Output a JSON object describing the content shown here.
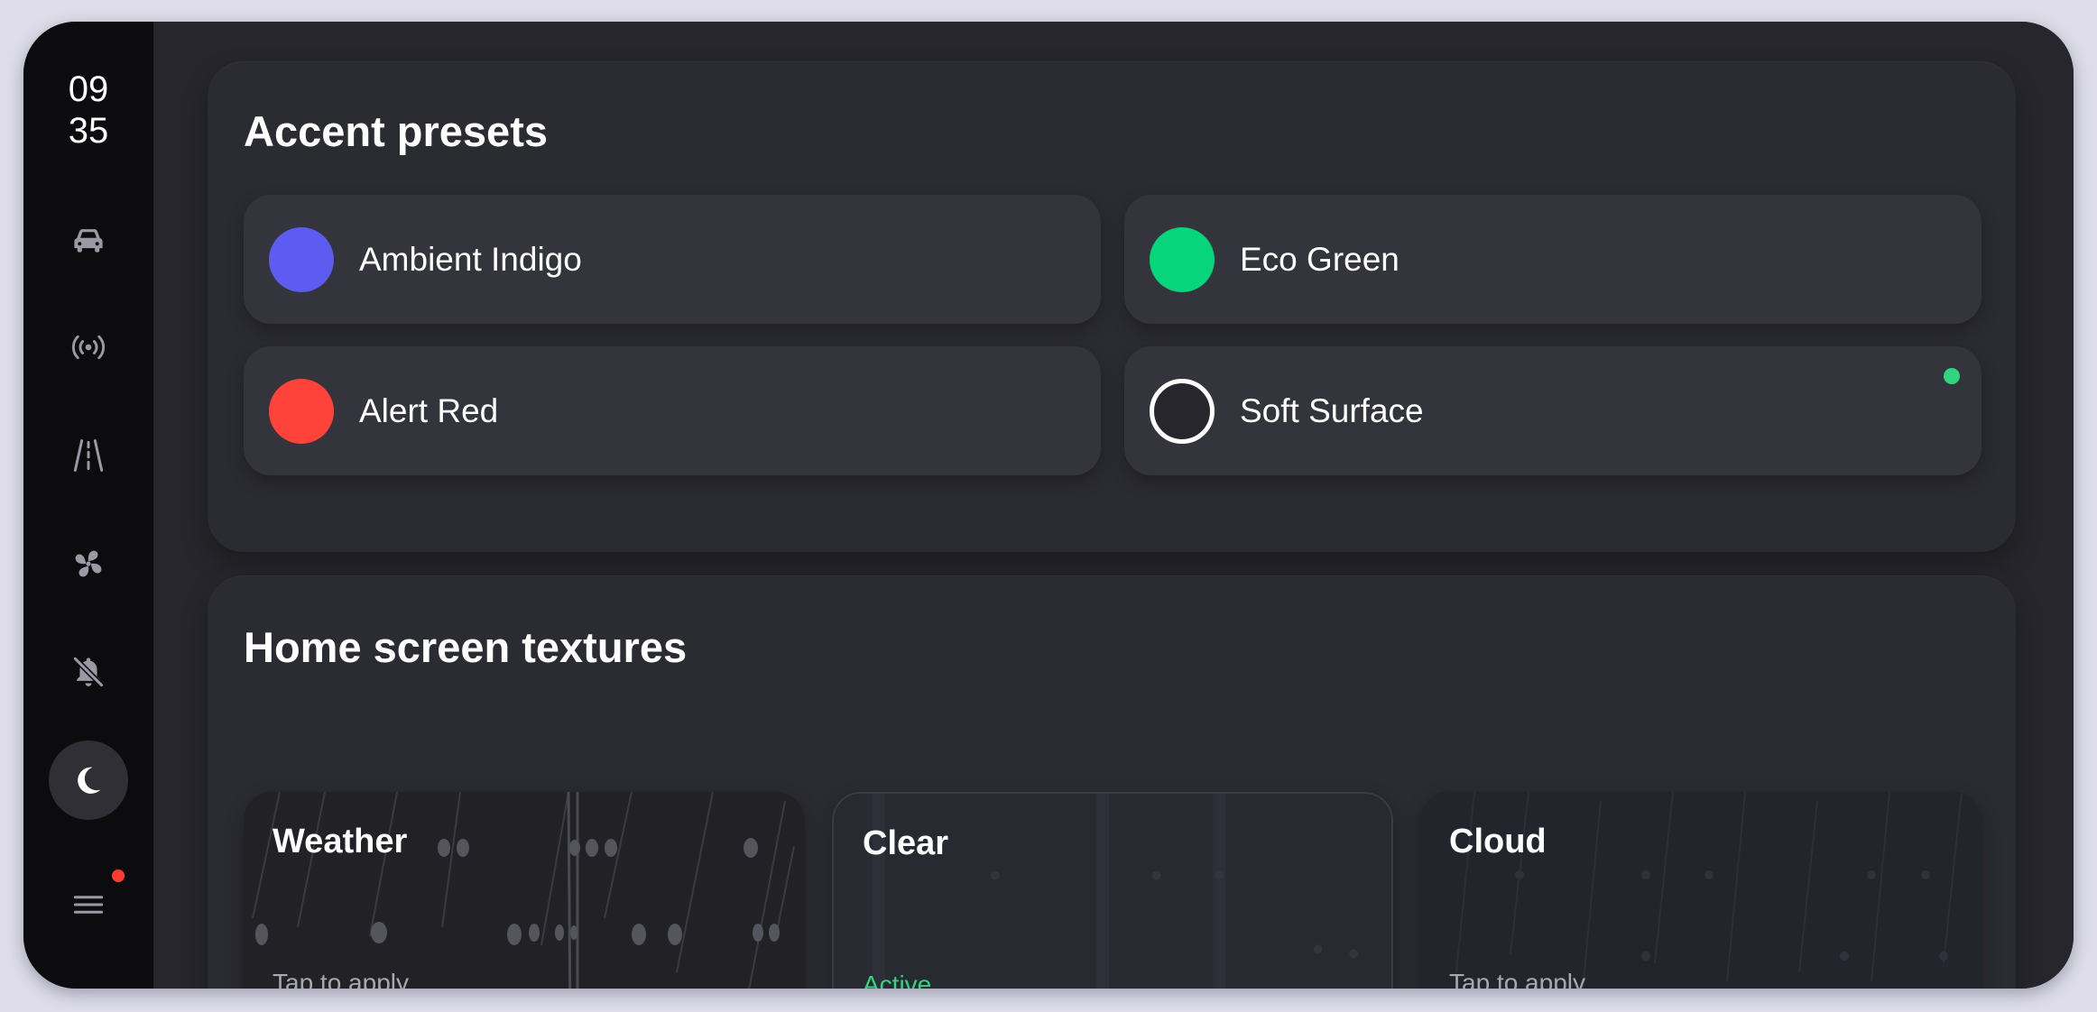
{
  "clock": {
    "hour": "09",
    "minute": "35"
  },
  "rail": {
    "items": [
      {
        "icon": "car-icon"
      },
      {
        "icon": "broadcast-icon"
      },
      {
        "icon": "road-icon"
      },
      {
        "icon": "fan-icon"
      },
      {
        "icon": "bell-off-icon"
      },
      {
        "icon": "moon-icon",
        "active": true
      },
      {
        "icon": "menu-icon",
        "has_notification": true
      }
    ]
  },
  "accent_presets": {
    "title": "Accent presets",
    "items": [
      {
        "label": "Ambient Indigo",
        "color": "#5c5cf0"
      },
      {
        "label": "Eco Green",
        "color": "#07d57b"
      },
      {
        "label": "Alert Red",
        "color": "#ff433a"
      },
      {
        "label": "Soft Surface",
        "color": "#26262c",
        "selected": true
      }
    ]
  },
  "textures": {
    "title": "Home screen textures",
    "items": [
      {
        "name": "Weather",
        "status": "Tap to apply"
      },
      {
        "name": "Clear",
        "status": "Active"
      },
      {
        "name": "Cloud",
        "status": "Tap to apply"
      }
    ]
  },
  "colors": {
    "accent_active": "#31d47f",
    "notification": "#ff3b30"
  }
}
